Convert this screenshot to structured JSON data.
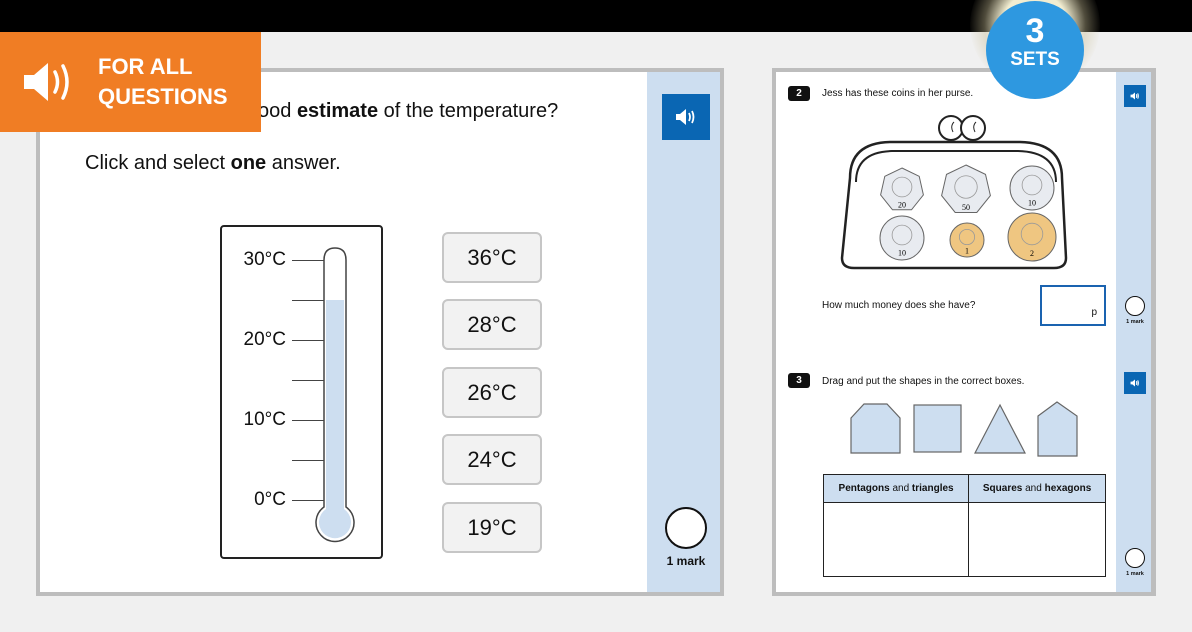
{
  "header": {
    "background": "#000000"
  },
  "badge_all": {
    "line1": "FOR ALL",
    "line2": "QUESTIONS",
    "icon": "speaker-icon",
    "color": "#f07d24"
  },
  "sets_badge": {
    "number": "3",
    "label": "SETS",
    "color": "#2e98e0"
  },
  "question1": {
    "title_pre": "ood ",
    "title_bold": "estimate",
    "title_post": " of the temperature?",
    "instruction_pre": "Click and select ",
    "instruction_bold": "one",
    "instruction_post": " answer.",
    "thermometer": {
      "labels": [
        "30°C",
        "20°C",
        "10°C",
        "0°C"
      ],
      "scale_min": 0,
      "scale_max": 30,
      "reading": 25
    },
    "answers": [
      "36°C",
      "28°C",
      "26°C",
      "24°C",
      "19°C"
    ],
    "mark_label": "1 mark",
    "audio_icon": "speaker-icon"
  },
  "question2": {
    "number": "2",
    "text": "Jess has these coins in her purse.",
    "coins": [
      "20p",
      "50p",
      "10p",
      "10p",
      "1p",
      "2p"
    ],
    "prompt": "How much money does she have?",
    "input_value": "",
    "input_suffix": "p",
    "mark_label": "1 mark"
  },
  "question3": {
    "number": "3",
    "text": "Drag and put the shapes in the correct boxes.",
    "shapes": [
      "hexagon",
      "square",
      "triangle",
      "pentagon"
    ],
    "table_headers": [
      {
        "bold1": "Pentagons",
        "mid": " and ",
        "bold2": "triangles"
      },
      {
        "bold1": "Squares",
        "mid": " and ",
        "bold2": "hexagons"
      }
    ],
    "mark_label": "1 mark"
  }
}
